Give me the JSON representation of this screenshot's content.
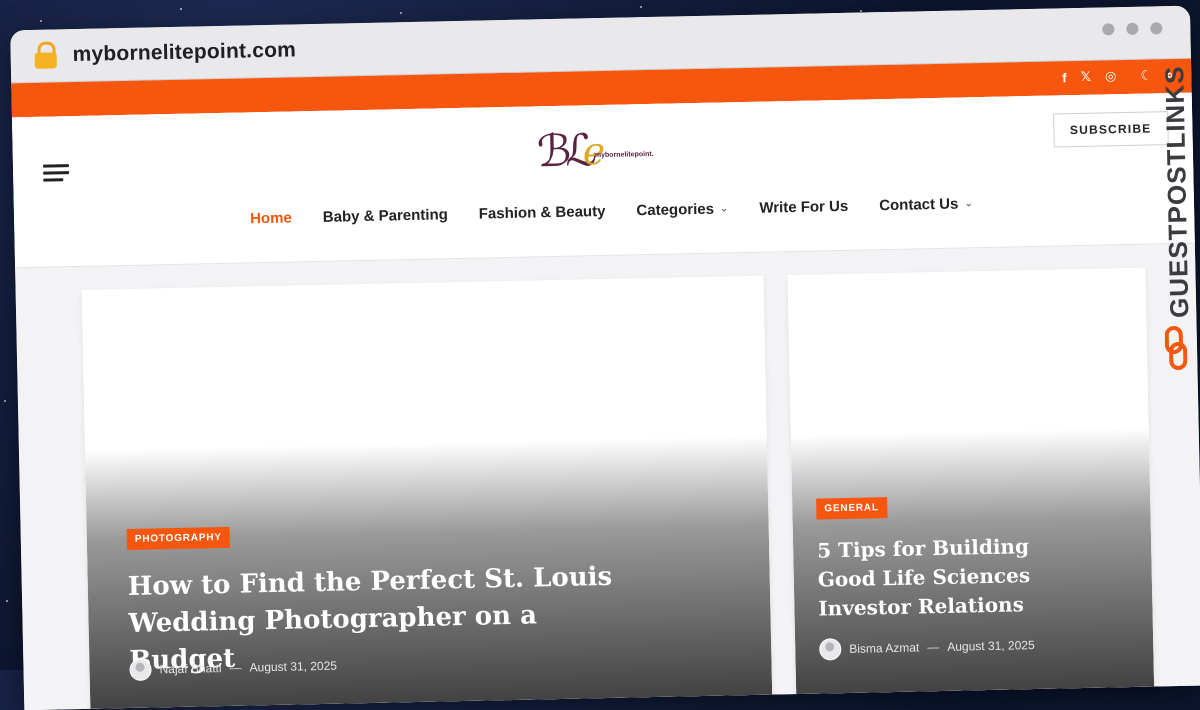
{
  "browser": {
    "url": "mybornelitepoint.com"
  },
  "topbar": {
    "social_icons": [
      "facebook-icon",
      "x-icon",
      "instagram-icon",
      "moon-icon",
      "search-icon"
    ]
  },
  "header": {
    "logo_text": "mybornelitepoint.",
    "subscribe_label": "SUBSCRIBE"
  },
  "nav": {
    "items": [
      {
        "label": "Home",
        "active": true
      },
      {
        "label": "Baby & Parenting"
      },
      {
        "label": "Fashion & Beauty"
      },
      {
        "label": "Categories"
      },
      {
        "label": "Write For Us"
      },
      {
        "label": "Contact Us"
      }
    ]
  },
  "posts": [
    {
      "category": "PHOTOGRAPHY",
      "title": "How to Find the Perfect St. Louis Wedding Photographer on a Budget",
      "author": "Najaf Bhatti",
      "date": "August 31, 2025"
    },
    {
      "category": "GENERAL",
      "title": "5 Tips for Building Good Life Sciences Investor Relations",
      "author": "Bisma Azmat",
      "date": "August 31, 2025"
    }
  ],
  "watermark": {
    "text": "GUESTPOSTLINKS"
  },
  "colors": {
    "accent": "#f6560e",
    "logo_purple": "#5b2140",
    "logo_gold": "#d9a92b"
  }
}
